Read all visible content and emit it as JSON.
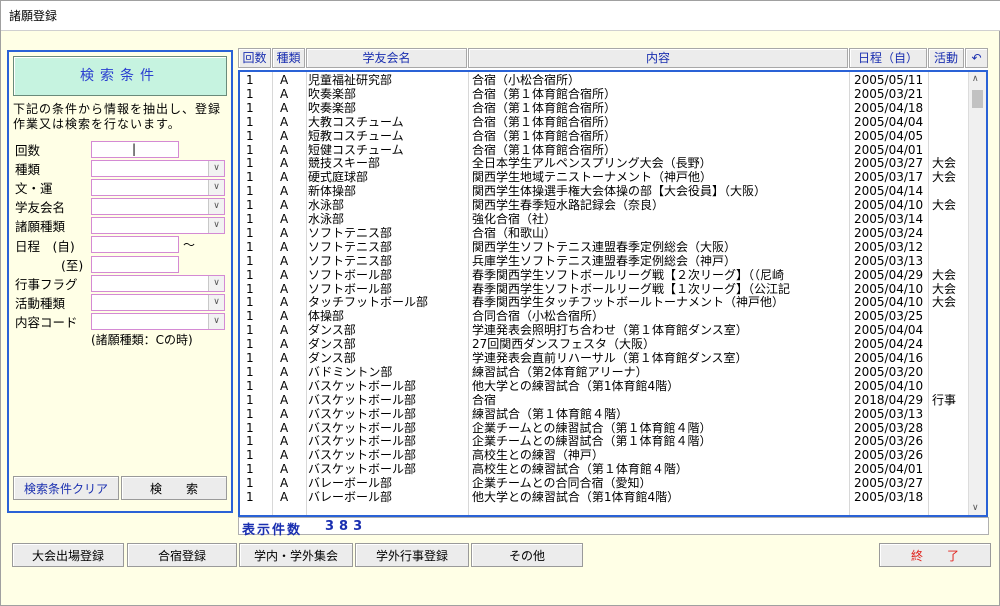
{
  "window": {
    "title": "諸願登録"
  },
  "search": {
    "header": "検索条件",
    "description": "下記の条件から情報を抽出し、登録作業又は検索を行ないます。",
    "fields": {
      "kaisu": {
        "label": "回数",
        "value": "|"
      },
      "shurui": {
        "label": "種類"
      },
      "bun_un": {
        "label": "文・運"
      },
      "gakuyukai": {
        "label": "学友会名"
      },
      "shogan": {
        "label": "諸願種類"
      },
      "nittei_from": {
        "label": "日程　(自)"
      },
      "tilde": "〜",
      "nittei_to": {
        "label": "(至)"
      },
      "gyoji": {
        "label": "行事フラグ"
      },
      "katsudo": {
        "label": "活動種類"
      },
      "naiyo": {
        "label": "内容コード"
      }
    },
    "note": "(諸願種類：Cの時)",
    "clear_button": "検索条件クリア",
    "search_button": "検　　索"
  },
  "table": {
    "columns": {
      "kaisu": "回数",
      "shurui": "種類",
      "gakuyukai": "学友会名",
      "naiyo": "内容",
      "nittei": "日程（自）",
      "katsudo": "活動",
      "back": "↶"
    },
    "rows": [
      [
        "1",
        "A",
        "児童福祉研究部",
        "合宿（小松合宿所）",
        "2005/05/11",
        ""
      ],
      [
        "1",
        "A",
        "吹奏楽部",
        "合宿（第１体育館合宿所）",
        "2005/03/21",
        ""
      ],
      [
        "1",
        "A",
        "吹奏楽部",
        "合宿（第１体育館合宿所）",
        "2005/04/18",
        ""
      ],
      [
        "1",
        "A",
        "大教コスチューム",
        "合宿（第１体育館合宿所）",
        "2005/04/04",
        ""
      ],
      [
        "1",
        "A",
        "短教コスチューム",
        "合宿（第１体育館合宿所）",
        "2005/04/05",
        ""
      ],
      [
        "1",
        "A",
        "短健コスチューム",
        "合宿（第１体育館合宿所）",
        "2005/04/01",
        ""
      ],
      [
        "1",
        "A",
        "競技スキー部",
        "全日本学生アルペンスプリング大会（長野）",
        "2005/03/27",
        "大会"
      ],
      [
        "1",
        "A",
        "硬式庭球部",
        "関西学生地域テニストーナメント（神戸他）",
        "2005/03/17",
        "大会"
      ],
      [
        "1",
        "A",
        "新体操部",
        "関西学生体操選手権大会体操の部【大会役員】（大阪）",
        "2005/04/14",
        ""
      ],
      [
        "1",
        "A",
        "水泳部",
        "関西学生春季短水路記録会（奈良）",
        "2005/04/10",
        "大会"
      ],
      [
        "1",
        "A",
        "水泳部",
        "強化合宿（社）",
        "2005/03/14",
        ""
      ],
      [
        "1",
        "A",
        "ソフトテニス部",
        "合宿（和歌山）",
        "2005/03/24",
        ""
      ],
      [
        "1",
        "A",
        "ソフトテニス部",
        "関西学生ソフトテニス連盟春季定例総会（大阪）",
        "2005/03/12",
        ""
      ],
      [
        "1",
        "A",
        "ソフトテニス部",
        "兵庫学生ソフトテニス連盟春季定例総会（神戸）",
        "2005/03/13",
        ""
      ],
      [
        "1",
        "A",
        "ソフトボール部",
        "春季関西学生ソフトボールリーグ戦【２次リーグ】（（尼崎",
        "2005/04/29",
        "大会"
      ],
      [
        "1",
        "A",
        "ソフトボール部",
        "春季関西学生ソフトボールリーグ戦【１次リーグ】（公江記",
        "2005/04/10",
        "大会"
      ],
      [
        "1",
        "A",
        "タッチフットボール部",
        "春季関西学生タッチフットボールトーナメント（神戸他）",
        "2005/04/10",
        "大会"
      ],
      [
        "1",
        "A",
        "体操部",
        "合同合宿（小松合宿所）",
        "2005/03/25",
        ""
      ],
      [
        "1",
        "A",
        "ダンス部",
        "学連発表会照明打ち合わせ（第１体育館ダンス室）",
        "2005/04/04",
        ""
      ],
      [
        "1",
        "A",
        "ダンス部",
        "27回関西ダンスフェスタ（大阪）",
        "2005/04/24",
        ""
      ],
      [
        "1",
        "A",
        "ダンス部",
        "学連発表会直前リハーサル（第１体育館ダンス室）",
        "2005/04/16",
        ""
      ],
      [
        "1",
        "A",
        "バドミントン部",
        "練習試合（第2体育館アリーナ）",
        "2005/03/20",
        ""
      ],
      [
        "1",
        "A",
        "バスケットボール部",
        "他大学との練習試合（第1体育館4階）",
        "2005/04/10",
        ""
      ],
      [
        "1",
        "A",
        "バスケットボール部",
        "合宿",
        "2018/04/29",
        "行事"
      ],
      [
        "1",
        "A",
        "バスケットボール部",
        "練習試合（第１体育館４階）",
        "2005/03/13",
        ""
      ],
      [
        "1",
        "A",
        "バスケットボール部",
        "企業チームとの練習試合（第１体育館４階）",
        "2005/03/28",
        ""
      ],
      [
        "1",
        "A",
        "バスケットボール部",
        "企業チームとの練習試合（第１体育館４階）",
        "2005/03/26",
        ""
      ],
      [
        "1",
        "A",
        "バスケットボール部",
        "高校生との練習（神戸）",
        "2005/03/26",
        ""
      ],
      [
        "1",
        "A",
        "バスケットボール部",
        "高校生との練習試合（第１体育館４階）",
        "2005/04/01",
        ""
      ],
      [
        "1",
        "A",
        "バレーボール部",
        "企業チームとの合同合宿（愛知）",
        "2005/03/27",
        ""
      ],
      [
        "1",
        "A",
        "バレーボール部",
        "他大学との練習試合（第1体育館4階）",
        "2005/03/18",
        ""
      ]
    ]
  },
  "count": {
    "label": "表示件数",
    "value": "383"
  },
  "bottom_buttons": {
    "taikai": "大会出場登録",
    "gasshuku": "合宿登録",
    "gakunai": "学内・学外集会",
    "gakugai": "学外行事登録",
    "sonota": "その他",
    "exit": "終　　了"
  },
  "colors": {
    "accent": "#2a62d6",
    "header_text": "#1a2fb0",
    "exit_text": "#e0201a",
    "background": "#ffffe6"
  }
}
